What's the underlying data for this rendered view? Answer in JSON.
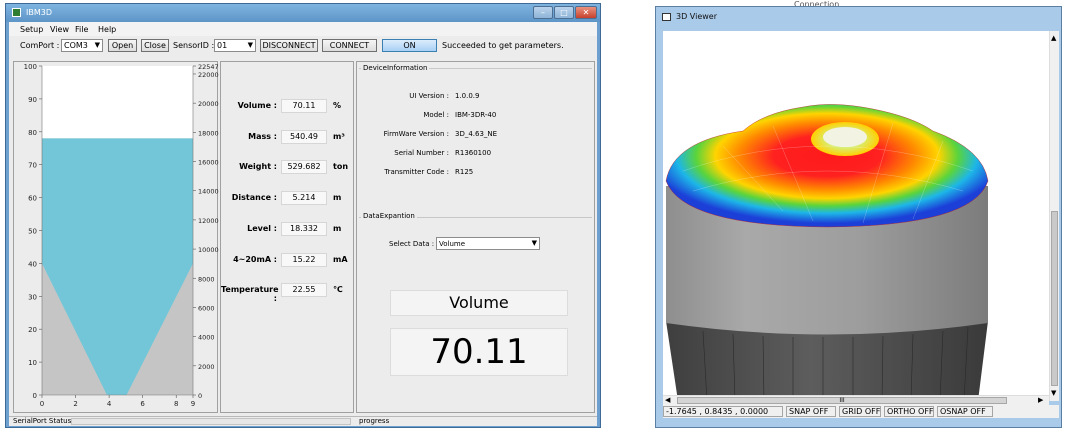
{
  "main_window": {
    "title": "IBM3D",
    "controls": {
      "minimize": "–",
      "maximize": "□",
      "close": "✕"
    },
    "menu": [
      "Setup",
      "View",
      "File",
      "Help"
    ],
    "toolbar": {
      "comport_label": "ComPort :",
      "comport_value": "COM3",
      "open_button": "Open",
      "close_button": "Close",
      "sensor_label": "SensorID :",
      "sensor_value": "01",
      "disconnect_button": "DISCONNECT",
      "connect_button": "CONNECT",
      "on_button": "ON",
      "status_message": "Succeeded to get parameters."
    },
    "gauge": {
      "fill_percent": 78,
      "left_ticks": [
        "100",
        "90",
        "80",
        "70",
        "60",
        "50",
        "40",
        "30",
        "20",
        "10",
        "0"
      ],
      "right_ticks": [
        "22547",
        "22000",
        "20000",
        "18000",
        "16000",
        "14000",
        "12000",
        "10000",
        "8000",
        "6000",
        "4000",
        "2000",
        "0"
      ],
      "bottom_ticks": [
        "0",
        "2",
        "4",
        "6",
        "8",
        "9"
      ],
      "colors": {
        "fill": "#72c6d8",
        "empty": "#ffffff",
        "background": "#c5c5c5"
      }
    },
    "values": [
      {
        "label": "Volume :",
        "value": "70.11",
        "unit": "%"
      },
      {
        "label": "Mass :",
        "value": "540.49",
        "unit": "m³"
      },
      {
        "label": "Weight :",
        "value": "529.682",
        "unit": "ton"
      },
      {
        "label": "Distance :",
        "value": "5.214",
        "unit": "m"
      },
      {
        "label": "Level :",
        "value": "18.332",
        "unit": "m"
      },
      {
        "label": "4~20mA :",
        "value": "15.22",
        "unit": "mA"
      },
      {
        "label": "Temperature :",
        "value": "22.55",
        "unit": "℃"
      }
    ],
    "device_info": {
      "group_title": "DeviceInformation",
      "rows": [
        {
          "label": "UI Version :",
          "value": "1.0.0.9"
        },
        {
          "label": "Model :",
          "value": "IBM-3DR-40"
        },
        {
          "label": "FirmWare Version :",
          "value": "3D_4.63_NE"
        },
        {
          "label": "Serial Number :",
          "value": "R1360100"
        },
        {
          "label": "Transmitter Code :",
          "value": "R125"
        }
      ]
    },
    "data_expansion": {
      "group_title": "DataExpantion",
      "select_label": "Select Data :",
      "select_value": "Volume"
    },
    "big_display": {
      "title": "Volume",
      "value": "70.11"
    },
    "statusbar": {
      "left": "SerialPort Status",
      "right": "progress"
    }
  },
  "viewer_window": {
    "title": "3D Viewer",
    "behind_title_fragment": "Connection",
    "status": {
      "coords": "-1.7645 , 0.8435 , 0.0000",
      "snap": "SNAP OFF",
      "grid": "GRID OFF",
      "ortho": "ORTHO OFF",
      "osnap": "OSNAP OFF"
    },
    "hscroll_grip": "III"
  }
}
